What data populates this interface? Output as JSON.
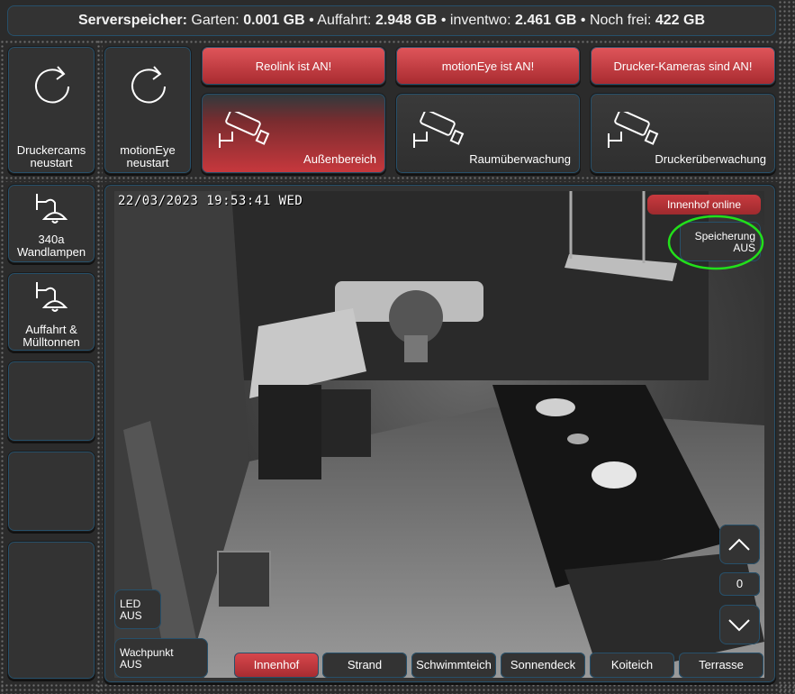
{
  "header": {
    "label": "Serverspeicher:",
    "items": [
      {
        "name": "Garten:",
        "value": "0.001 GB"
      },
      {
        "name": "Auffahrt:",
        "value": "2.948 GB"
      },
      {
        "name": "inventwo:",
        "value": "2.461 GB"
      },
      {
        "name": "Noch frei:",
        "value": "422 GB"
      }
    ],
    "separator": "•"
  },
  "restart": [
    {
      "line1": "Druckercams",
      "line2": "neustart"
    },
    {
      "line1": "motionEye",
      "line2": "neustart"
    }
  ],
  "status": [
    {
      "label": "Reolink ist AN!"
    },
    {
      "label": "motionEye ist AN!"
    },
    {
      "label": "Drucker-Kameras sind AN!"
    }
  ],
  "camera_groups": [
    {
      "label": "Außenbereich",
      "active": true
    },
    {
      "label": "Raumüberwachung",
      "active": false
    },
    {
      "label": "Druckerüberwachung",
      "active": false
    }
  ],
  "sidebar": [
    {
      "line1": "340a",
      "line2": "Wandlampen"
    },
    {
      "line1": "Auffahrt &",
      "line2": "Mülltonnen"
    },
    {
      "line1": "",
      "line2": ""
    },
    {
      "line1": "",
      "line2": ""
    },
    {
      "line1": "",
      "line2": ""
    }
  ],
  "video": {
    "timestamp": "22/03/2023 19:53:41 WED",
    "online_badge": "Innenhof online",
    "recording": {
      "line1": "Speicherung",
      "line2": "AUS"
    },
    "led": {
      "line1": "LED",
      "line2": "AUS"
    },
    "watchpoint": {
      "line1": "Wachpunkt",
      "line2": "AUS"
    },
    "counter": "0"
  },
  "cameras": [
    {
      "label": "Innenhof",
      "active": true
    },
    {
      "label": "Strand",
      "active": false
    },
    {
      "label": "Schwimmteich",
      "active": false
    },
    {
      "label": "Sonnendeck",
      "active": false
    },
    {
      "label": "Koiteich",
      "active": false
    },
    {
      "label": "Terrasse",
      "active": false
    }
  ],
  "colors": {
    "accent_red": "#c83a3f",
    "highlight_green": "#22e01a",
    "border_blue": "#27506a"
  }
}
